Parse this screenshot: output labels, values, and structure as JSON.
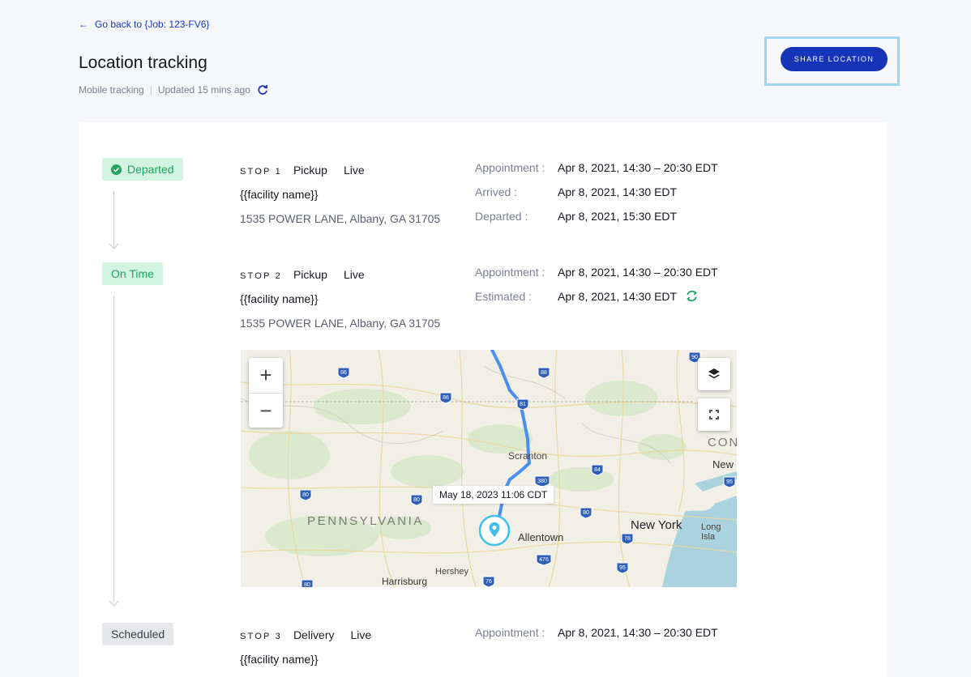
{
  "header": {
    "back_label": "Go back to {Job: 123-FV6}",
    "title": "Location tracking",
    "tracking_mode": "Mobile tracking",
    "updated": "Updated 15 mins ago",
    "share_label": "SHARE LOCATION"
  },
  "stops": [
    {
      "status": "Departed",
      "label": "STOP 1",
      "type": "Pickup",
      "mode": "Live",
      "facility": "{{facility name}}",
      "address": "1535 POWER LANE, Albany, GA 31705",
      "details": [
        {
          "label": "Appointment :",
          "value": "Apr 8, 2021, 14:30 – 20:30 EDT"
        },
        {
          "label": "Arrived :",
          "value": "Apr 8, 2021, 14:30 EDT"
        },
        {
          "label": "Departed :",
          "value": "Apr 8, 2021, 15:30 EDT"
        }
      ]
    },
    {
      "status": "On Time",
      "label": "STOP 2",
      "type": "Pickup",
      "mode": "Live",
      "facility": "{{facility name}}",
      "address": "1535 POWER LANE, Albany, GA 31705",
      "details": [
        {
          "label": "Appointment :",
          "value": "Apr 8, 2021, 14:30 – 20:30 EDT"
        },
        {
          "label": "Estimated :",
          "value": "Apr 8, 2021, 14:30 EDT"
        }
      ]
    },
    {
      "status": "Scheduled",
      "label": "STOP 3",
      "type": "Delivery",
      "mode": "Live",
      "facility": "{{facility name}}",
      "details": [
        {
          "label": "Appointment :",
          "value": "Apr 8, 2021, 14:30 – 20:30 EDT"
        }
      ]
    }
  ],
  "map": {
    "tooltip": "May 18, 2023 11:06 CDT",
    "zoom_in": "+",
    "zoom_out": "−",
    "places": {
      "scranton": "Scranton",
      "pennsylvania": "PENNSYLVANIA",
      "allentown": "Allentown",
      "new_york": "New York",
      "new": "New",
      "con": "CON",
      "long_island": "Long Isla",
      "harrisburg": "Harrisburg",
      "hershey": "Hershey"
    },
    "highways": [
      "86",
      "88",
      "81",
      "86",
      "380",
      "84",
      "80",
      "80",
      "80",
      "78",
      "476",
      "95",
      "95",
      "76",
      "90",
      "80"
    ]
  },
  "colors": {
    "accent": "#1634b8",
    "link": "#1b37b8",
    "status_green": "#22a460",
    "route_blue": "#4a8ef0",
    "marker": "#3fc0ec"
  },
  "icons": {
    "back": "arrow-left-icon",
    "refresh": "refresh-icon",
    "check": "check-circle-icon",
    "sync": "sync-icon",
    "layers": "layers-icon",
    "fullscreen": "fullscreen-icon",
    "marker": "location-marker-icon"
  }
}
